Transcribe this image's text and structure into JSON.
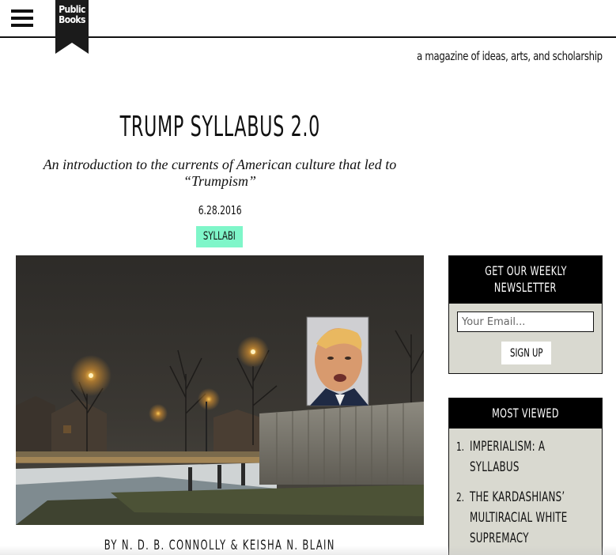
{
  "header": {
    "logo_lines": [
      "Public",
      "Books"
    ],
    "tagline": "a magazine of ideas, arts, and scholarship"
  },
  "article": {
    "title": "TRUMP SYLLABUS 2.0",
    "subtitle": "An introduction to the currents of American culture that led to “Trumpism”",
    "date": "6.28.2016",
    "tag": "SYLLABI",
    "byline": "BY N. D. B. CONNOLLY & KEISHA N. BLAIN"
  },
  "newsletter": {
    "heading": [
      "GET OUR WEEKLY",
      "NEWSLETTER"
    ],
    "email_placeholder": "Your Email...",
    "email_value": "",
    "button": "SIGN UP"
  },
  "most_viewed": {
    "heading": "MOST VIEWED",
    "items": [
      {
        "num": "1.",
        "lines": [
          "IMPERIALISM: A",
          "SYLLABUS"
        ]
      },
      {
        "num": "2.",
        "lines": [
          "THE KARDASHIANS’",
          "MULTIRACIAL WHITE",
          "SUPREMACY"
        ]
      }
    ]
  },
  "colors": {
    "accent_tag": "#7ff6c9",
    "sidebar_bg": "#d9d9d0",
    "panel_head_bg": "#000000"
  }
}
